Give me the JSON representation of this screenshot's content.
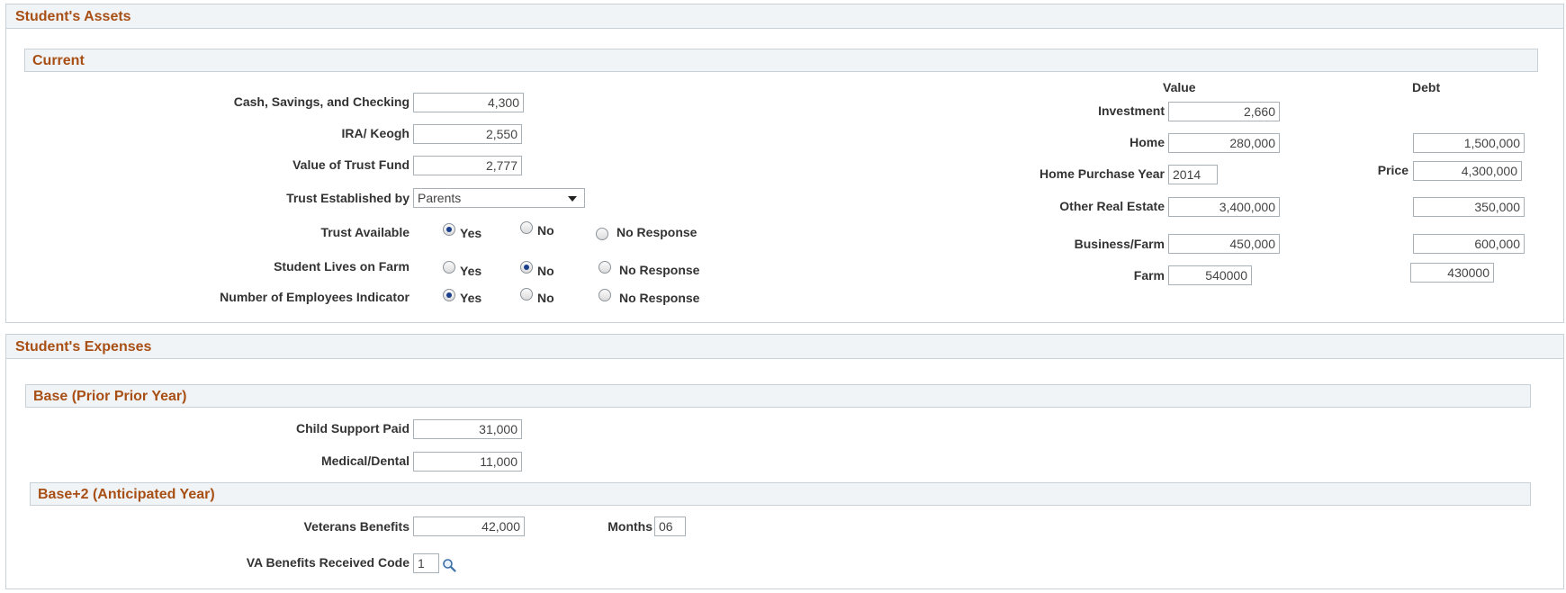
{
  "assets": {
    "title": "Student's Assets",
    "current_title": "Current",
    "cash_label": "Cash, Savings, and Checking",
    "cash_value": "4,300",
    "ira_label": "IRA/ Keogh",
    "ira_value": "2,550",
    "trust_fund_label": "Value of Trust Fund",
    "trust_fund_value": "2,777",
    "trust_established_label": "Trust Established by",
    "trust_established_value": "Parents",
    "trust_available_label": "Trust Available",
    "lives_on_farm_label": "Student Lives on Farm",
    "employees_label": "Number of Employees Indicator",
    "radio_yes": "Yes",
    "radio_no": "No",
    "radio_no_response": "No Response",
    "value_header": "Value",
    "debt_header": "Debt",
    "investment_label": "Investment",
    "investment_value": "2,660",
    "home_label": "Home",
    "home_value": "280,000",
    "home_debt": "1,500,000",
    "home_purchase_year_label": "Home Purchase Year",
    "home_purchase_year": "2014",
    "price_label": "Price",
    "price_value": "4,300,000",
    "other_real_estate_label": "Other Real Estate",
    "other_real_estate_value": "3,400,000",
    "other_real_estate_debt": "350,000",
    "business_farm_label": "Business/Farm",
    "business_farm_value": "450,000",
    "business_farm_debt": "600,000",
    "farm_label": "Farm",
    "farm_value": "540000",
    "farm_debt": "430000"
  },
  "expenses": {
    "title": "Student's Expenses",
    "base_title": "Base (Prior Prior Year)",
    "child_support_label": "Child Support Paid",
    "child_support_value": "31,000",
    "medical_label": "Medical/Dental",
    "medical_value": "11,000",
    "base2_title": "Base+2 (Anticipated Year)",
    "veterans_label": "Veterans Benefits",
    "veterans_value": "42,000",
    "months_label": "Months",
    "months_value": "06",
    "va_code_label": "VA Benefits Received Code",
    "va_code_value": "1"
  },
  "icons": {
    "lookup": "search-icon"
  },
  "colors": {
    "section_title": "#a84f15",
    "header_bg": "#f1f4f6",
    "border": "#c8d0d8"
  }
}
